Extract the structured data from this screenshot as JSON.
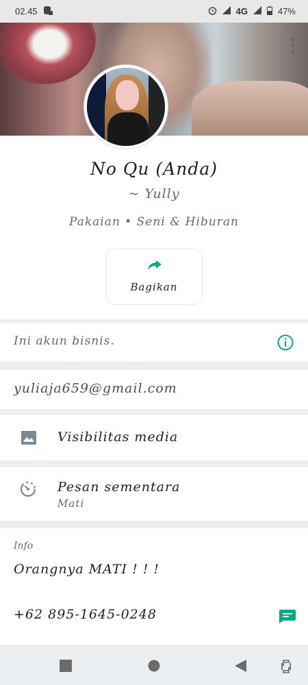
{
  "status_bar": {
    "time": "02.45",
    "network": "4G",
    "battery": "47%",
    "icons": [
      "storage-icon",
      "alarm-icon",
      "signal-icon",
      "signal-icon",
      "battery-icon"
    ]
  },
  "profile": {
    "name": "No Qu (Anda)",
    "subname": "~ Yully",
    "category": "Pakaian • Seni & Hiburan"
  },
  "actions": {
    "share_label": "Bagikan",
    "share_icon": "share-icon"
  },
  "business": {
    "text": "Ini akun bisnis."
  },
  "contact": {
    "email": "yuliaja659@gmail.com"
  },
  "settings": {
    "media_visibility": "Visibilitas media",
    "disappearing_title": "Pesan sementara",
    "disappearing_value": "Mati"
  },
  "info": {
    "label": "Info",
    "about": "Orangnya MATI ! ! !",
    "phone": "+62 895-1645-0248"
  },
  "colors": {
    "accent": "#00a884",
    "muted": "#5e6a72"
  },
  "nav": {
    "icons": [
      "recent-apps-icon",
      "home-icon",
      "back-icon",
      "rotate-icon"
    ]
  }
}
